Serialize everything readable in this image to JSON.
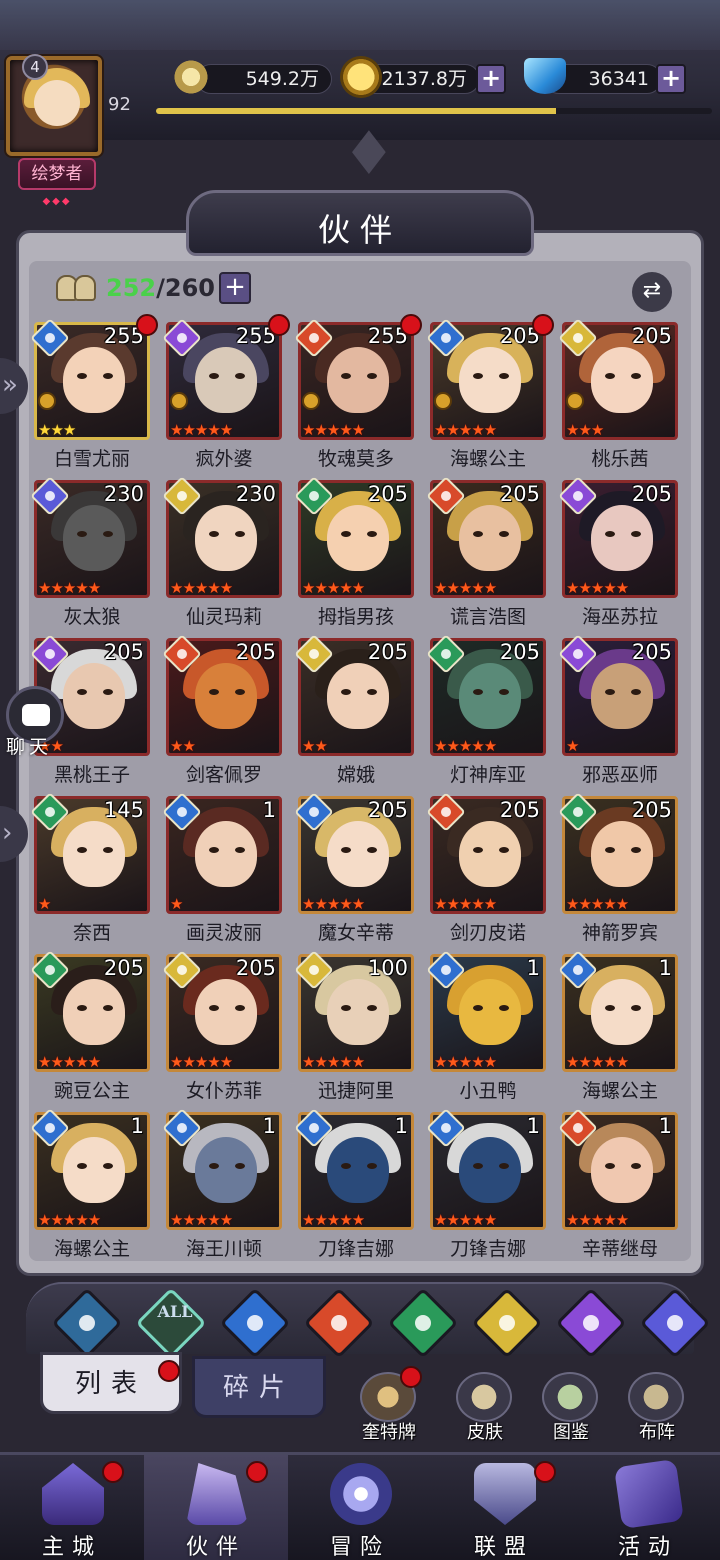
{
  "player": {
    "avatar_level": "4",
    "level": "92",
    "title": "绘梦者",
    "exp_fraction": 0.72
  },
  "resources": {
    "power": "549.2万",
    "gold": "2137.8万",
    "gems": "36341"
  },
  "page": {
    "title": "伙伴"
  },
  "roster": {
    "current": "252",
    "max": "260"
  },
  "heroes": [
    {
      "name": "白雪尤丽",
      "level": "255",
      "element": "water",
      "stars": 3,
      "star_color": "gold",
      "frame": "gold",
      "dot": true,
      "lock": true,
      "colors": [
        "#3a2a26",
        "#5a3a2e",
        "#f3d2b8"
      ]
    },
    {
      "name": "疯外婆",
      "level": "255",
      "element": "arcane",
      "stars": 5,
      "star_color": "red",
      "frame": "red",
      "dot": true,
      "lock": true,
      "colors": [
        "#2e2a3a",
        "#4a4660",
        "#d9c9b8"
      ]
    },
    {
      "name": "牧魂莫多",
      "level": "255",
      "element": "fire",
      "stars": 5,
      "star_color": "red",
      "frame": "red",
      "dot": true,
      "lock": true,
      "colors": [
        "#3a2622",
        "#4a2a22",
        "#e3b8a0"
      ]
    },
    {
      "name": "海螺公主",
      "level": "205",
      "element": "water",
      "stars": 5,
      "star_color": "red",
      "frame": "red",
      "dot": true,
      "lock": true,
      "colors": [
        "#4a3a2a",
        "#d8b25a",
        "#f5dcc8"
      ]
    },
    {
      "name": "桃乐茜",
      "level": "205",
      "element": "light",
      "stars": 3,
      "star_color": "red",
      "frame": "red",
      "dot": false,
      "lock": true,
      "colors": [
        "#5a2a22",
        "#b0643a",
        "#f5d5c0"
      ]
    },
    {
      "name": "灰太狼",
      "level": "230",
      "element": "cosmic",
      "stars": 5,
      "star_color": "red",
      "frame": "red",
      "dot": false,
      "lock": false,
      "colors": [
        "#3a2a26",
        "#3a3838",
        "#5a5a5a"
      ]
    },
    {
      "name": "仙灵玛莉",
      "level": "230",
      "element": "light",
      "stars": 5,
      "star_color": "red",
      "frame": "red",
      "dot": false,
      "lock": false,
      "colors": [
        "#3a3026",
        "#2a2420",
        "#f0d5c0"
      ]
    },
    {
      "name": "拇指男孩",
      "level": "205",
      "element": "wind",
      "stars": 5,
      "star_color": "red",
      "frame": "red",
      "dot": false,
      "lock": false,
      "colors": [
        "#2e3a26",
        "#d8b048",
        "#f5d0b0"
      ]
    },
    {
      "name": "谎言浩图",
      "level": "205",
      "element": "fire",
      "stars": 5,
      "star_color": "red",
      "frame": "red",
      "dot": false,
      "lock": false,
      "colors": [
        "#3a2a1e",
        "#c8a048",
        "#e8c0a0"
      ]
    },
    {
      "name": "海巫苏拉",
      "level": "205",
      "element": "arcane",
      "stars": 5,
      "star_color": "red",
      "frame": "red",
      "dot": false,
      "lock": false,
      "colors": [
        "#3a1e30",
        "#1e1a26",
        "#e8c8c0"
      ]
    },
    {
      "name": "黑桃王子",
      "level": "205",
      "element": "arcane",
      "stars": 2,
      "star_color": "red",
      "frame": "red",
      "dot": false,
      "lock": false,
      "colors": [
        "#3a2a30",
        "#d8d8d8",
        "#e8c8b0"
      ]
    },
    {
      "name": "剑客佩罗",
      "level": "205",
      "element": "fire",
      "stars": 2,
      "star_color": "red",
      "frame": "red",
      "dot": false,
      "lock": false,
      "colors": [
        "#4a1a1a",
        "#c8582a",
        "#d8803a"
      ]
    },
    {
      "name": "嫦娥",
      "level": "205",
      "element": "light",
      "stars": 2,
      "star_color": "red",
      "frame": "red",
      "dot": false,
      "lock": false,
      "colors": [
        "#3a2e26",
        "#2a201a",
        "#f0d0b8"
      ]
    },
    {
      "name": "灯神库亚",
      "level": "205",
      "element": "wind",
      "stars": 5,
      "star_color": "red",
      "frame": "red",
      "dot": false,
      "lock": false,
      "colors": [
        "#1e2a26",
        "#3a5a4a",
        "#5a8a78"
      ]
    },
    {
      "name": "邪恶巫师",
      "level": "205",
      "element": "arcane",
      "stars": 1,
      "star_color": "red",
      "frame": "red",
      "dot": false,
      "lock": false,
      "colors": [
        "#2a1e3a",
        "#6a3a8a",
        "#c8a078"
      ]
    },
    {
      "name": "奈西",
      "level": "145",
      "element": "wind",
      "stars": 1,
      "star_color": "red",
      "frame": "red",
      "dot": false,
      "lock": false,
      "colors": [
        "#4a3a2a",
        "#d8b060",
        "#f5dcc8"
      ]
    },
    {
      "name": "画灵波丽",
      "level": "1",
      "element": "water",
      "stars": 1,
      "star_color": "red",
      "frame": "red",
      "dot": false,
      "lock": false,
      "colors": [
        "#3a2620",
        "#5a2a22",
        "#f0d0b8"
      ]
    },
    {
      "name": "魔女辛蒂",
      "level": "205",
      "element": "water",
      "stars": 5,
      "star_color": "red",
      "frame": "bronze",
      "dot": false,
      "lock": false,
      "colors": [
        "#3a3630",
        "#d8b868",
        "#f5dcc8"
      ]
    },
    {
      "name": "剑刃皮诺",
      "level": "205",
      "element": "fire",
      "stars": 5,
      "star_color": "red",
      "frame": "red",
      "dot": false,
      "lock": false,
      "colors": [
        "#3a2a22",
        "#3a2a22",
        "#f0d0b0"
      ]
    },
    {
      "name": "神箭罗宾",
      "level": "205",
      "element": "wind",
      "stars": 5,
      "star_color": "red",
      "frame": "bronze",
      "dot": false,
      "lock": false,
      "colors": [
        "#3a3020",
        "#6a3a22",
        "#f0c8a8"
      ]
    },
    {
      "name": "豌豆公主",
      "level": "205",
      "element": "wind",
      "stars": 5,
      "star_color": "red",
      "frame": "bronze",
      "dot": false,
      "lock": false,
      "colors": [
        "#3a3a22",
        "#2a1e1a",
        "#f0d0b8"
      ]
    },
    {
      "name": "女仆苏菲",
      "level": "205",
      "element": "light",
      "stars": 5,
      "star_color": "red",
      "frame": "bronze",
      "dot": false,
      "lock": false,
      "colors": [
        "#3a2a22",
        "#6a2a1e",
        "#f0d0b8"
      ]
    },
    {
      "name": "迅捷阿里",
      "level": "100",
      "element": "light",
      "stars": 5,
      "star_color": "red",
      "frame": "bronze",
      "dot": false,
      "lock": false,
      "colors": [
        "#3a3630",
        "#d8c8a0",
        "#e8d0b8"
      ]
    },
    {
      "name": "小丑鸭",
      "level": "1",
      "element": "water",
      "stars": 5,
      "star_color": "red",
      "frame": "bronze",
      "dot": false,
      "lock": false,
      "colors": [
        "#2a3a4a",
        "#d8a030",
        "#e8b840"
      ]
    },
    {
      "name": "海螺公主",
      "level": "1",
      "element": "water",
      "stars": 5,
      "star_color": "red",
      "frame": "bronze",
      "dot": false,
      "lock": false,
      "colors": [
        "#3a3020",
        "#d8b060",
        "#f5dcc8"
      ]
    },
    {
      "name": "海螺公主",
      "level": "1",
      "element": "water",
      "stars": 5,
      "star_color": "red",
      "frame": "bronze",
      "dot": false,
      "lock": false,
      "colors": [
        "#3a3020",
        "#d8b060",
        "#f5dcc8"
      ]
    },
    {
      "name": "海王川顿",
      "level": "1",
      "element": "water",
      "stars": 5,
      "star_color": "red",
      "frame": "bronze",
      "dot": false,
      "lock": false,
      "colors": [
        "#3a3020",
        "#b8b8c0",
        "#6a7a9a"
      ]
    },
    {
      "name": "刀锋吉娜",
      "level": "1",
      "element": "water",
      "stars": 5,
      "star_color": "red",
      "frame": "bronze",
      "dot": false,
      "lock": false,
      "colors": [
        "#2a2a30",
        "#d8d8d8",
        "#2a4a7a"
      ]
    },
    {
      "name": "刀锋吉娜",
      "level": "1",
      "element": "water",
      "stars": 5,
      "star_color": "red",
      "frame": "bronze",
      "dot": false,
      "lock": false,
      "colors": [
        "#2a2a30",
        "#d8d8d8",
        "#2a4a7a"
      ]
    },
    {
      "name": "辛蒂继母",
      "level": "1",
      "element": "fire",
      "stars": 5,
      "star_color": "red",
      "frame": "bronze",
      "dot": false,
      "lock": false,
      "colors": [
        "#3a2a20",
        "#b8885a",
        "#f0c8b0"
      ]
    }
  ],
  "element_colors": {
    "water": "#2f6fcf",
    "arcane": "#8a4ad6",
    "fire": "#d84a2a",
    "light": "#d8b83a",
    "cosmic": "#5a5ad8",
    "wind": "#2a9a5a",
    "nature": "#2f6a9a"
  },
  "filters": [
    {
      "id": "guild",
      "color": "#2f6a9a"
    },
    {
      "id": "all",
      "label": "ALL",
      "color": "#2c4a3a"
    },
    {
      "id": "water",
      "color": "#2f6fcf"
    },
    {
      "id": "fire",
      "color": "#d84a2a"
    },
    {
      "id": "wind",
      "color": "#2a9a5a"
    },
    {
      "id": "light",
      "color": "#d8b83a"
    },
    {
      "id": "arcane",
      "color": "#8a4ad6"
    },
    {
      "id": "cosmic",
      "color": "#5a5ad8"
    }
  ],
  "subtabs": {
    "list": "列表",
    "fragments": "碎片"
  },
  "quick_actions": {
    "tarot": "奎特牌",
    "skin": "皮肤",
    "codex": "图鉴",
    "formation": "布阵"
  },
  "chat": {
    "label": "聊天"
  },
  "nav": {
    "city": "主城",
    "partners": "伙伴",
    "adventure": "冒险",
    "alliance": "联盟",
    "events": "活动"
  }
}
